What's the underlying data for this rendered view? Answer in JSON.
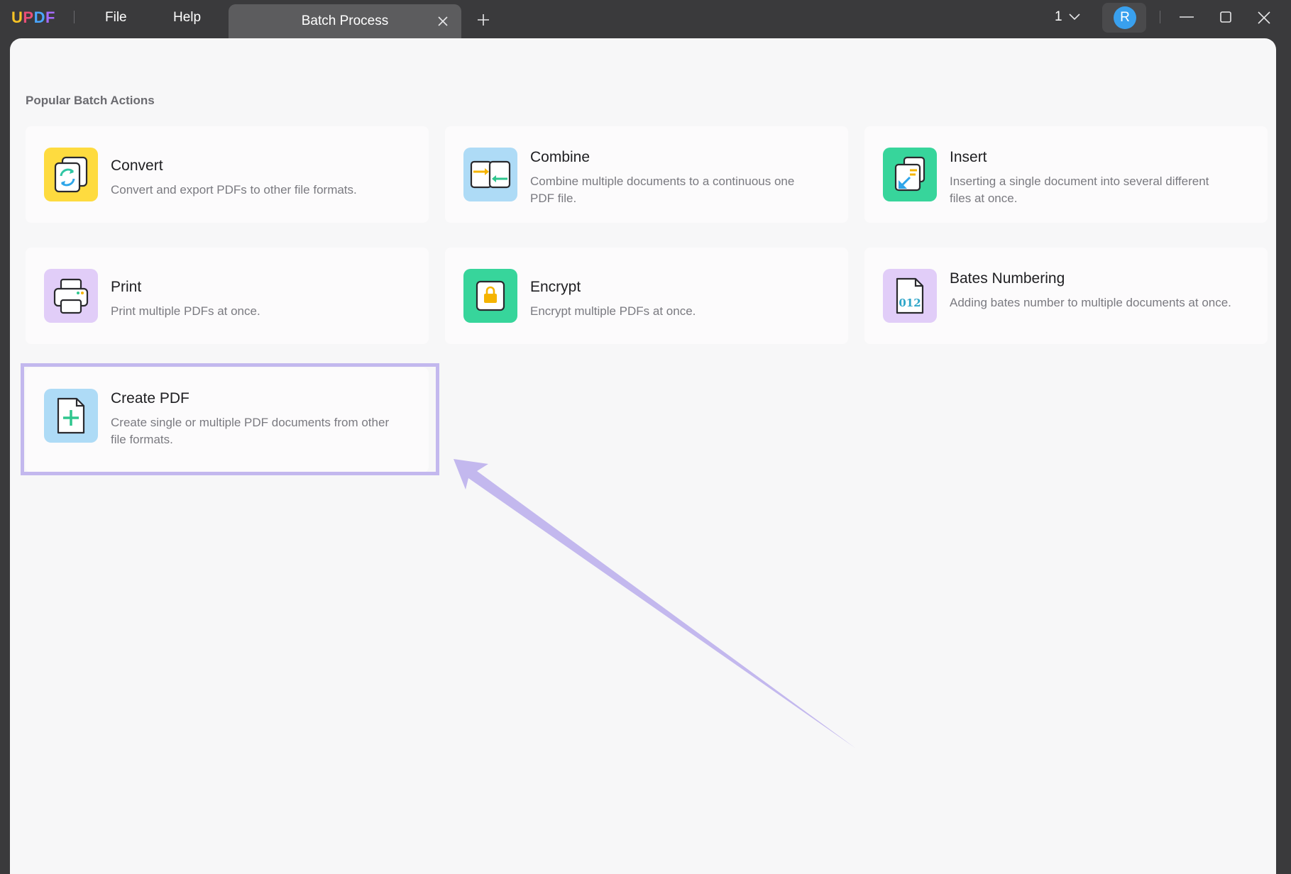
{
  "app": {
    "logo": {
      "u": "U",
      "p": "P",
      "d": "D",
      "f": "F"
    },
    "menu": {
      "file": "File",
      "help": "Help"
    },
    "tab": {
      "label": "Batch Process"
    },
    "page_switch": {
      "value": "1"
    },
    "user": {
      "avatar_initial": "R"
    },
    "icons": {
      "tab_close": "close-icon",
      "add_tab": "plus-icon",
      "page_switch": "chevron-down-icon",
      "minimize": "minimize-icon",
      "maximize": "maximize-icon",
      "close": "close-icon"
    }
  },
  "main": {
    "section_title": "Popular Batch Actions",
    "cards": [
      {
        "title": "Convert",
        "desc": "Convert and export PDFs to other file formats.",
        "icon": "convert-icon",
        "color": "#fedb3f"
      },
      {
        "title": "Combine",
        "desc": "Combine multiple documents to a continuous one PDF file.",
        "icon": "combine-icon",
        "color": "#aedbf6"
      },
      {
        "title": "Insert",
        "desc": "Inserting a single document into several different files at once.",
        "icon": "insert-icon",
        "color": "#37d59b"
      },
      {
        "title": "Print",
        "desc": "Print multiple PDFs at once.",
        "icon": "printer-icon",
        "color": "#e1cdf8"
      },
      {
        "title": "Encrypt",
        "desc": "Encrypt multiple PDFs at once.",
        "icon": "lock-icon",
        "color": "#37d59b"
      },
      {
        "title": "Bates Numbering",
        "desc": "Adding bates number to multiple documents at once.",
        "icon": "bates-number-icon",
        "icon_text": "012",
        "color": "#e1cdf8"
      },
      {
        "title": "Create PDF",
        "desc": "Create single or multiple PDF documents from other file formats.",
        "icon": "create-pdf-icon",
        "color": "#aedbf6"
      }
    ]
  },
  "colors": {
    "highlight": "#c3b8ee",
    "arrow": "#c3b8ee",
    "avatar": "#39a0ee"
  }
}
